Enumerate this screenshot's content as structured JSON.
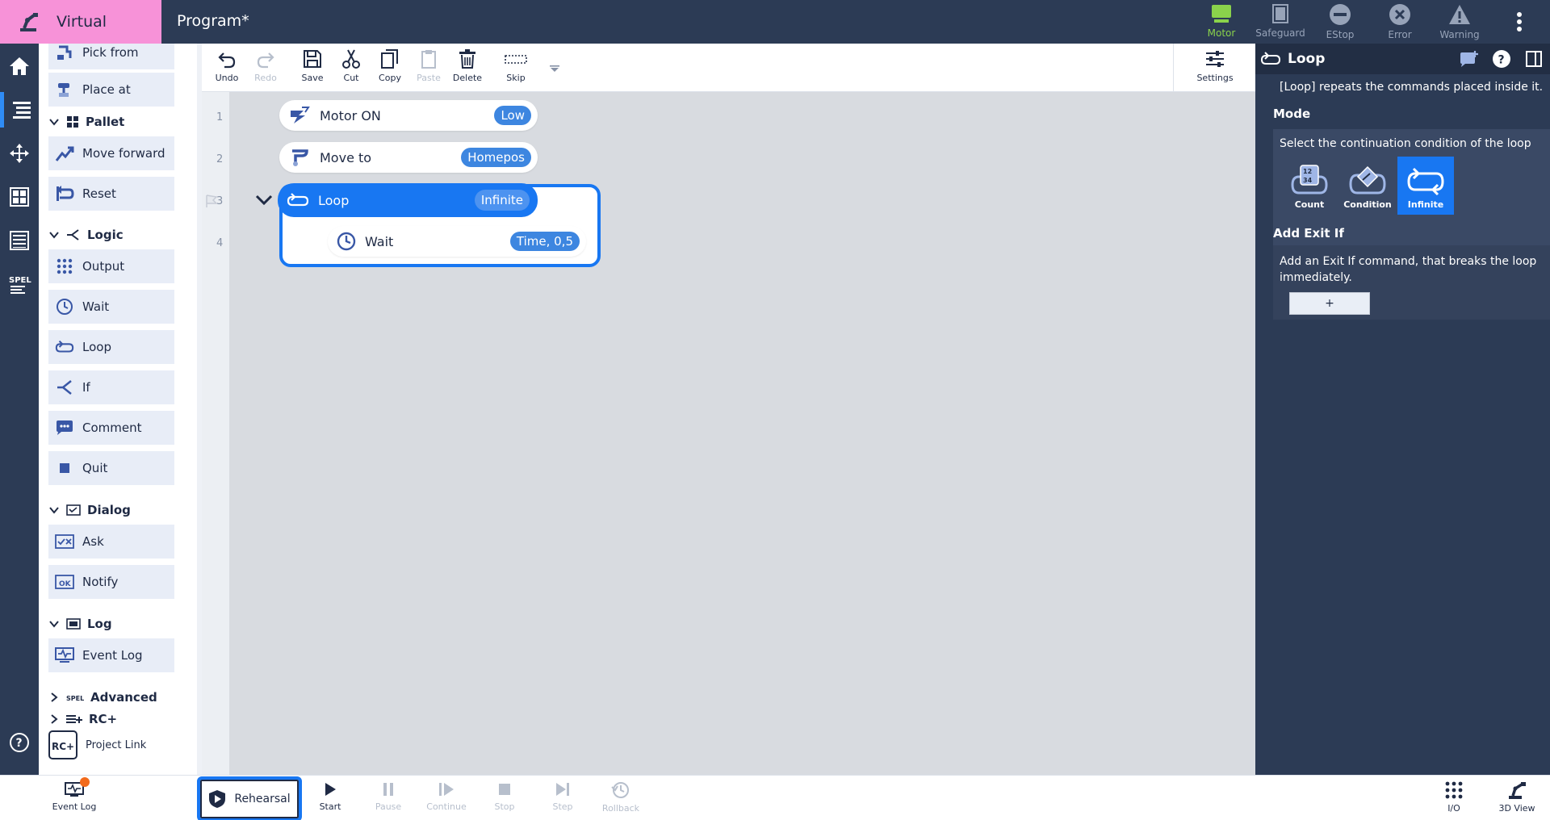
{
  "header": {
    "mode_label": "Virtual",
    "program_title": "Program*"
  },
  "status": [
    {
      "label": "Motor",
      "state": "active"
    },
    {
      "label": "Safeguard",
      "state": "inactive"
    },
    {
      "label": "EStop",
      "state": "inactive"
    },
    {
      "label": "Error",
      "state": "inactive"
    },
    {
      "label": "Warning",
      "state": "inactive"
    }
  ],
  "palette": {
    "items_top": [
      "Pick from",
      "Place at"
    ],
    "pallet": {
      "label": "Pallet",
      "items": [
        "Move forward",
        "Reset"
      ]
    },
    "logic": {
      "label": "Logic",
      "items": [
        "Output",
        "Wait",
        "Loop",
        "If",
        "Comment",
        "Quit"
      ]
    },
    "dialog": {
      "label": "Dialog",
      "items": [
        "Ask",
        "Notify"
      ]
    },
    "log": {
      "label": "Log",
      "items": [
        "Event Log"
      ]
    },
    "advanced": {
      "label": "Advanced"
    },
    "rcplus": {
      "label": "RC+",
      "project_link": "Project Link"
    }
  },
  "toolbar": {
    "undo": "Undo",
    "redo": "Redo",
    "save": "Save",
    "cut": "Cut",
    "copy": "Copy",
    "paste": "Paste",
    "delete": "Delete",
    "skip": "Skip",
    "settings": "Settings"
  },
  "program": {
    "line_numbers": [
      "1",
      "2",
      "3",
      "4"
    ],
    "commands": [
      {
        "label": "Motor ON",
        "badge": "Low"
      },
      {
        "label": "Move to",
        "badge": "Homepos"
      },
      {
        "label": "Loop",
        "badge": "Infinite"
      },
      {
        "label": "Wait",
        "badge": "Time, 0,5"
      }
    ]
  },
  "properties": {
    "title": "Loop",
    "description": "[Loop] repeats the commands placed inside it.",
    "mode_heading": "Mode",
    "mode_hint": "Select the continuation condition of the loop",
    "modes": [
      "Count",
      "Condition",
      "Infinite"
    ],
    "selected_mode": "Infinite",
    "exit_heading": "Add Exit If",
    "exit_hint_1": "Add an Exit If command, that breaks the loop",
    "exit_hint_2": "immediately.",
    "plus": "+"
  },
  "bottom": {
    "event_log": "Event Log",
    "rehearsal": "Rehearsal",
    "start": "Start",
    "pause": "Pause",
    "continue": "Continue",
    "stop": "Stop",
    "step": "Step",
    "rollback": "Rollback",
    "io": "I/O",
    "view3d": "3D View"
  },
  "colors": {
    "accent": "#1877f2",
    "sidebar": "#2c3b55",
    "virtual_bg": "#f792d8",
    "motor_on": "#8ad24b"
  }
}
